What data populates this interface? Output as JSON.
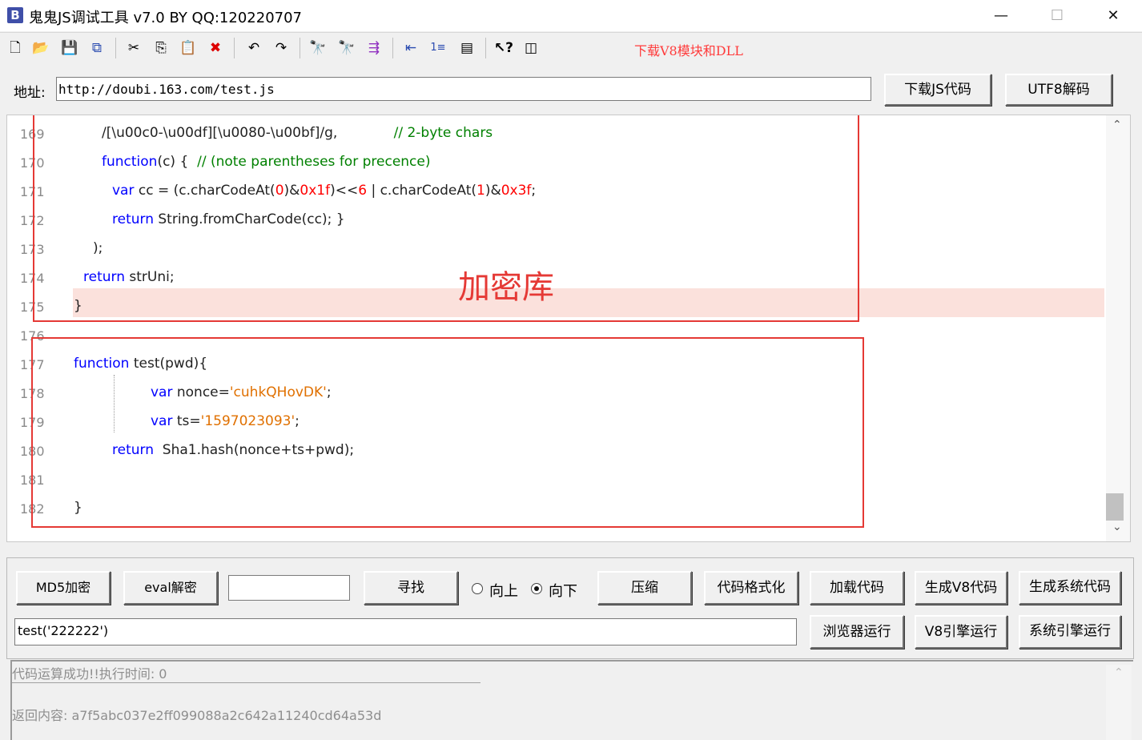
{
  "window": {
    "app_icon_letter": "B",
    "title": "鬼鬼JS调试工具 v7.0 BY QQ:120220707",
    "minimize_glyph": "—",
    "maximize_glyph": "☐",
    "close_glyph": "✕"
  },
  "toolbar": {
    "download_v8_link": "下载V8模块和DLL",
    "icons": [
      "new-file-icon",
      "open-folder-icon",
      "save-icon",
      "save-all-icon",
      "cut-icon",
      "copy-icon",
      "paste-icon",
      "delete-icon",
      "undo-icon",
      "redo-icon",
      "find-icon",
      "find-next-icon",
      "indent-icon",
      "outdent-icon",
      "line-numbers-icon",
      "window-icon",
      "help-icon",
      "panel-icon"
    ]
  },
  "address": {
    "label": "地址:",
    "url": "http://doubi.163.com/test.js",
    "download_js_button": "下载JS代码",
    "utf8_decode_button": "UTF8解码"
  },
  "editor": {
    "annotation": "加密库",
    "lines": [
      {
        "num": "169",
        "segments": [
          {
            "t": "/[\\u00c0-\\u00df][\\u0080-\\u00bf]/g,             ",
            "c": "txt"
          },
          {
            "t": "// 2-byte chars",
            "c": "cm"
          }
        ]
      },
      {
        "num": "170",
        "segments": [
          {
            "t": "function",
            "c": "kw"
          },
          {
            "t": "(c) {  ",
            "c": "txt"
          },
          {
            "t": "// (note parentheses for precence)",
            "c": "cm"
          }
        ]
      },
      {
        "num": "171",
        "segments": [
          {
            "t": "var",
            "c": "kw"
          },
          {
            "t": " cc = (c.charCodeAt(",
            "c": "txt"
          },
          {
            "t": "0",
            "c": "num"
          },
          {
            "t": ")&",
            "c": "txt"
          },
          {
            "t": "0x1f",
            "c": "num"
          },
          {
            "t": ")<<",
            "c": "txt"
          },
          {
            "t": "6",
            "c": "num"
          },
          {
            "t": " | c.charCodeAt(",
            "c": "txt"
          },
          {
            "t": "1",
            "c": "num"
          },
          {
            "t": ")&",
            "c": "txt"
          },
          {
            "t": "0x3f",
            "c": "num"
          },
          {
            "t": ";",
            "c": "txt"
          }
        ]
      },
      {
        "num": "172",
        "segments": [
          {
            "t": "return",
            "c": "kw"
          },
          {
            "t": " String.fromCharCode(cc); }",
            "c": "txt"
          }
        ]
      },
      {
        "num": "173",
        "segments": [
          {
            "t": ");",
            "c": "txt"
          }
        ]
      },
      {
        "num": "174",
        "segments": [
          {
            "t": "return",
            "c": "kw"
          },
          {
            "t": " strUni;",
            "c": "txt"
          }
        ]
      },
      {
        "num": "175",
        "segments": [
          {
            "t": "}",
            "c": "txt"
          }
        ]
      },
      {
        "num": "176",
        "segments": []
      },
      {
        "num": "177",
        "segments": [
          {
            "t": "function",
            "c": "kw"
          },
          {
            "t": " test(pwd){",
            "c": "txt"
          }
        ]
      },
      {
        "num": "178",
        "segments": [
          {
            "t": "var",
            "c": "kw"
          },
          {
            "t": " nonce=",
            "c": "txt"
          },
          {
            "t": "'cuhkQHovDK'",
            "c": "str"
          },
          {
            "t": ";",
            "c": "txt"
          }
        ]
      },
      {
        "num": "179",
        "segments": [
          {
            "t": "var",
            "c": "kw"
          },
          {
            "t": " ts=",
            "c": "txt"
          },
          {
            "t": "'1597023093'",
            "c": "str"
          },
          {
            "t": ";",
            "c": "txt"
          }
        ]
      },
      {
        "num": "180",
        "segments": [
          {
            "t": "return",
            "c": "kw"
          },
          {
            "t": "  Sha1.hash(nonce+ts+pwd);",
            "c": "txt"
          }
        ]
      },
      {
        "num": "181",
        "segments": []
      },
      {
        "num": "182",
        "segments": [
          {
            "t": "}",
            "c": "txt"
          }
        ]
      }
    ]
  },
  "controls": {
    "md5_button": "MD5加密",
    "eval_button": "eval解密",
    "find_value": "",
    "find_button": "寻找",
    "radio_up": "向上",
    "radio_down": "向下",
    "compress_button": "压缩",
    "format_button": "代码格式化",
    "load_button": "加载代码",
    "gen_v8_button": "生成V8代码",
    "gen_sys_button": "生成系统代码",
    "command_value": "test('222222')",
    "browser_run_button": "浏览器运行",
    "v8_run_button": "V8引擎运行",
    "sys_run_button": "系统引擎运行"
  },
  "output": {
    "status": "代码运算成功!!执行时间: 0",
    "result": "返回内容: a7f5abc037e2ff099088a2c642a11240cd64a53d"
  },
  "colors": {
    "keyword": "#0000ff",
    "comment": "#008000",
    "number": "#ff0000",
    "string": "#e07000",
    "highlight": "#fbe1dc",
    "annotation": "#e53935",
    "link": "#ff3b3b"
  }
}
